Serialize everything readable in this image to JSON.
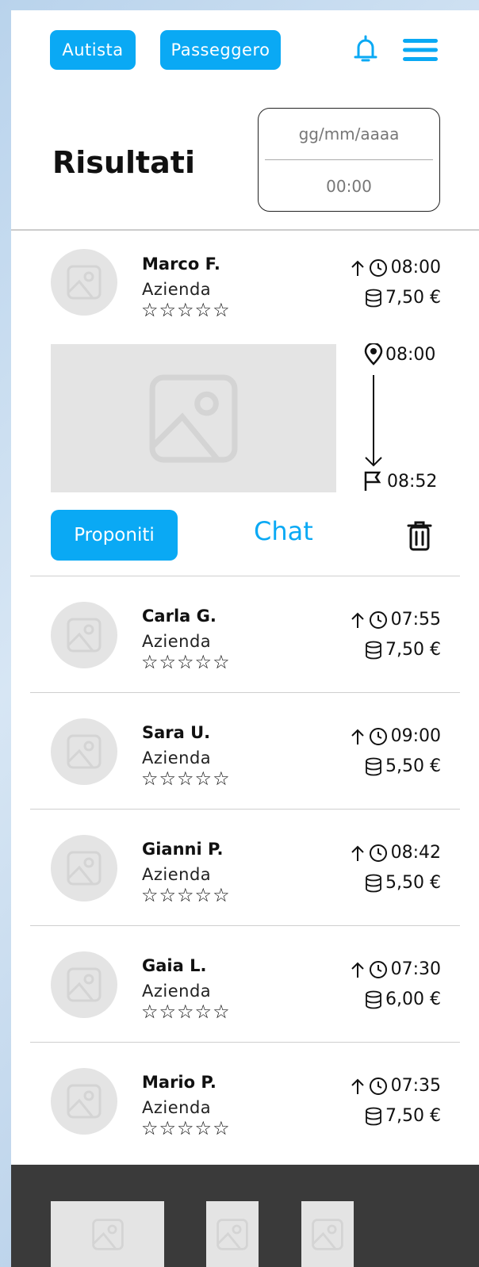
{
  "header": {
    "tab_driver": "Autista",
    "tab_passenger": "Passeggero",
    "title": "Risultati",
    "date_placeholder": "gg/mm/aaaa",
    "time_placeholder": "00:00"
  },
  "expanded": {
    "route_start_time": "08:00",
    "route_end_time": "08:52",
    "propose_label": "Proponiti",
    "chat_label": "Chat"
  },
  "results": [
    {
      "name": "Marco F.",
      "company": "Azienda",
      "stars": "☆☆☆☆☆",
      "departure": "08:00",
      "price": "7,50 €"
    },
    {
      "name": "Carla G.",
      "company": "Azienda",
      "stars": "☆☆☆☆☆",
      "departure": "07:55",
      "price": "7,50 €"
    },
    {
      "name": "Sara U.",
      "company": "Azienda",
      "stars": "☆☆☆☆☆",
      "departure": "09:00",
      "price": "5,50 €"
    },
    {
      "name": "Gianni P.",
      "company": "Azienda",
      "stars": "☆☆☆☆☆",
      "departure": "08:42",
      "price": "5,50 €"
    },
    {
      "name": "Gaia L.",
      "company": "Azienda",
      "stars": "☆☆☆☆☆",
      "departure": "07:30",
      "price": "6,00 €"
    },
    {
      "name": "Mario P.",
      "company": "Azienda",
      "stars": "☆☆☆☆☆",
      "departure": "07:35",
      "price": "7,50 €"
    }
  ],
  "colors": {
    "accent": "#0aa9f4",
    "footer": "#3a3a3a",
    "placeholder": "#e4e4e4"
  }
}
